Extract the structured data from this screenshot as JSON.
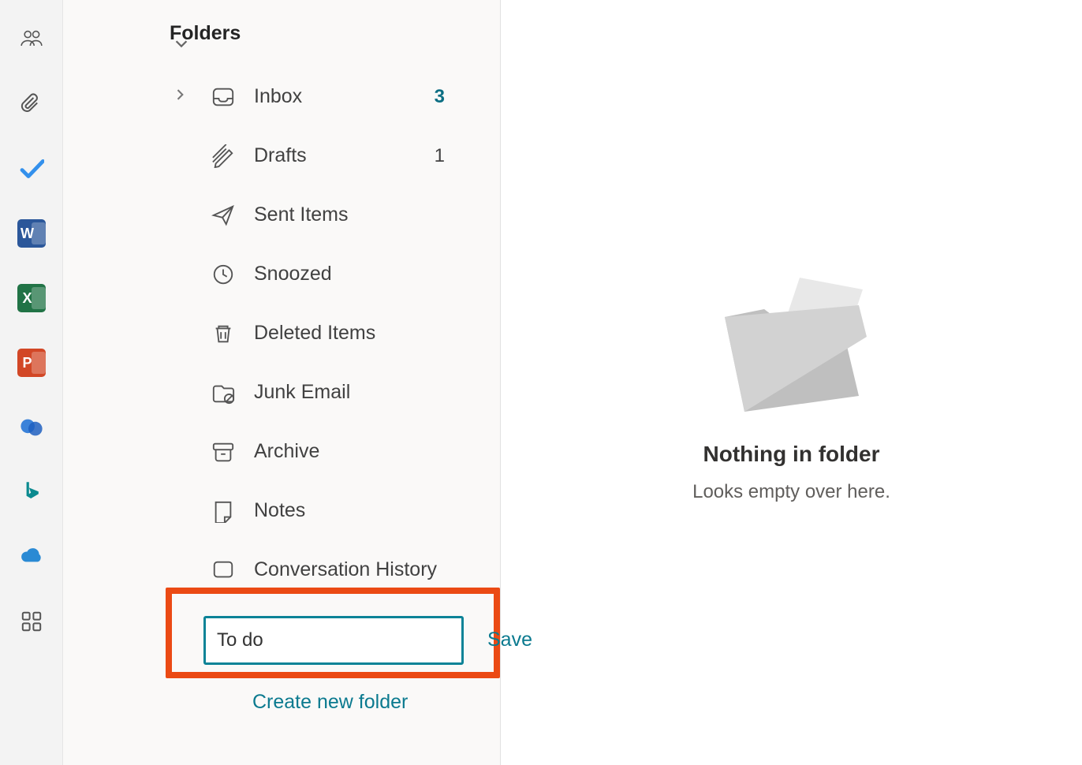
{
  "rail": {
    "icons": [
      "people",
      "attachment",
      "todo",
      "word",
      "excel",
      "powerpoint",
      "viva",
      "bing",
      "onedrive",
      "apps"
    ]
  },
  "folders": {
    "section_label": "Folders",
    "items": [
      {
        "id": "inbox",
        "label": "Inbox",
        "count": "3",
        "count_accent": true,
        "expandable": true
      },
      {
        "id": "drafts",
        "label": "Drafts",
        "count": "1"
      },
      {
        "id": "sent",
        "label": "Sent Items"
      },
      {
        "id": "snoozed",
        "label": "Snoozed"
      },
      {
        "id": "deleted",
        "label": "Deleted Items"
      },
      {
        "id": "junk",
        "label": "Junk Email"
      },
      {
        "id": "archive",
        "label": "Archive"
      },
      {
        "id": "notes",
        "label": "Notes"
      },
      {
        "id": "convhist",
        "label": "Conversation History"
      }
    ],
    "new_folder_value": "To do",
    "save_label": "Save",
    "create_label": "Create new folder"
  },
  "empty": {
    "title": "Nothing in folder",
    "subtitle": "Looks empty over here."
  }
}
